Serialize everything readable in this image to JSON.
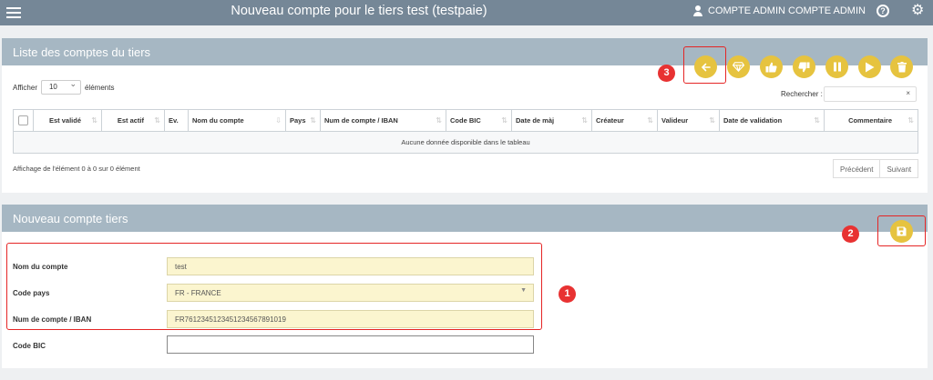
{
  "header": {
    "title": "Nouveau compte pour le tiers test (testpaie)",
    "user": "COMPTE ADMIN COMPTE ADMIN",
    "help_icon": "?",
    "settings_icon": "⚙"
  },
  "list_panel": {
    "title": "Liste des comptes du tiers",
    "show_label": "Afficher",
    "page_length": "10",
    "elements_label": "éléments",
    "search_label": "Rechercher :",
    "search_clear": "×",
    "columns": [
      "Est validé",
      "Est actif",
      "Ev.",
      "Nom du compte",
      "Pays",
      "Num de compte / IBAN",
      "Code BIC",
      "Date de màj",
      "Créateur",
      "Valideur",
      "Date de validation",
      "Commentaire"
    ],
    "empty_message": "Aucune donnée disponible dans le tableau",
    "info": "Affichage de l'élément 0 à 0 sur 0 élément",
    "prev": "Précédent",
    "next": "Suivant",
    "actions": [
      "back-arrow-icon",
      "diamond-icon",
      "thumbs-up-icon",
      "thumbs-down-icon",
      "pause-icon",
      "play-icon",
      "trash-icon"
    ]
  },
  "form_panel": {
    "title": "Nouveau compte tiers",
    "fields": [
      {
        "label": "Nom du compte",
        "value": "test"
      },
      {
        "label": "Code pays",
        "value": "FR - FRANCE"
      },
      {
        "label": "Num de compte / IBAN",
        "value": "FR7612345123451234567891019"
      },
      {
        "label": "Code BIC",
        "value": ""
      }
    ],
    "save_icon": "save-icon"
  },
  "callouts": [
    "1",
    "2",
    "3"
  ],
  "colors": {
    "topbar": "#758797",
    "panel_header": "#a6b7c3",
    "action_button": "#e6c33f",
    "highlight": "#e52525",
    "field_bg": "#fbf5cf"
  }
}
